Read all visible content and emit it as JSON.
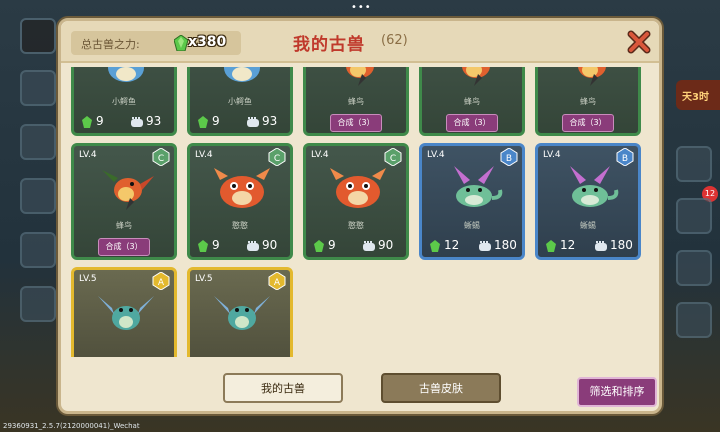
{
  "header": {
    "power_label": "总古兽之力:",
    "power_value": "x380",
    "title": "我的古兽",
    "count": "(62)"
  },
  "cards": [
    {
      "level": "",
      "rank": "",
      "name": "小鳄鱼",
      "gem": "9",
      "power": "93",
      "combine": "",
      "border": "green",
      "beast": "blue-dragon"
    },
    {
      "level": "",
      "rank": "",
      "name": "小鳄鱼",
      "gem": "9",
      "power": "93",
      "combine": "",
      "border": "green",
      "beast": "blue-dragon"
    },
    {
      "level": "",
      "rank": "",
      "name": "蜂鸟",
      "gem": "",
      "power": "",
      "combine": "合成（3）",
      "border": "green",
      "beast": "bird"
    },
    {
      "level": "",
      "rank": "",
      "name": "蜂鸟",
      "gem": "",
      "power": "",
      "combine": "合成（3）",
      "border": "green",
      "beast": "bird"
    },
    {
      "level": "",
      "rank": "",
      "name": "蜂鸟",
      "gem": "",
      "power": "",
      "combine": "合成（3）",
      "border": "green",
      "beast": "bird"
    },
    {
      "level": "LV.4",
      "rank": "C",
      "name": "蜂鸟",
      "gem": "",
      "power": "",
      "combine": "合成（3）",
      "border": "green",
      "beast": "bird"
    },
    {
      "level": "LV.4",
      "rank": "C",
      "name": "憨憨",
      "gem": "9",
      "power": "90",
      "combine": "",
      "border": "green",
      "beast": "red-pig"
    },
    {
      "level": "LV.4",
      "rank": "C",
      "name": "憨憨",
      "gem": "9",
      "power": "90",
      "combine": "",
      "border": "green",
      "beast": "red-pig"
    },
    {
      "level": "LV.4",
      "rank": "B",
      "name": "蜥蜴",
      "gem": "12",
      "power": "180",
      "combine": "",
      "border": "blue",
      "beast": "lizard"
    },
    {
      "level": "LV.4",
      "rank": "B",
      "name": "蜥蜴",
      "gem": "12",
      "power": "180",
      "combine": "",
      "border": "blue",
      "beast": "lizard"
    },
    {
      "level": "LV.5",
      "rank": "A",
      "name": "",
      "gem": "",
      "power": "",
      "combine": "",
      "border": "gold",
      "beast": "teal-dragon"
    },
    {
      "level": "LV.5",
      "rank": "A",
      "name": "",
      "gem": "",
      "power": "",
      "combine": "",
      "border": "gold",
      "beast": "teal-dragon"
    }
  ],
  "tabs": {
    "mine": "我的古兽",
    "skin": "古兽皮肤"
  },
  "filter_label": "筛选和排序",
  "side": {
    "right_badge": "天3时",
    "right_count": "12"
  },
  "version": "29360931_2.5.7(2120000041)_Wechat",
  "colors": {
    "title": "#c0392b",
    "combine": "#8a3c7a",
    "green_border": "#3f8a4a",
    "blue_border": "#4a86c9",
    "gold_border": "#e3b92e"
  }
}
